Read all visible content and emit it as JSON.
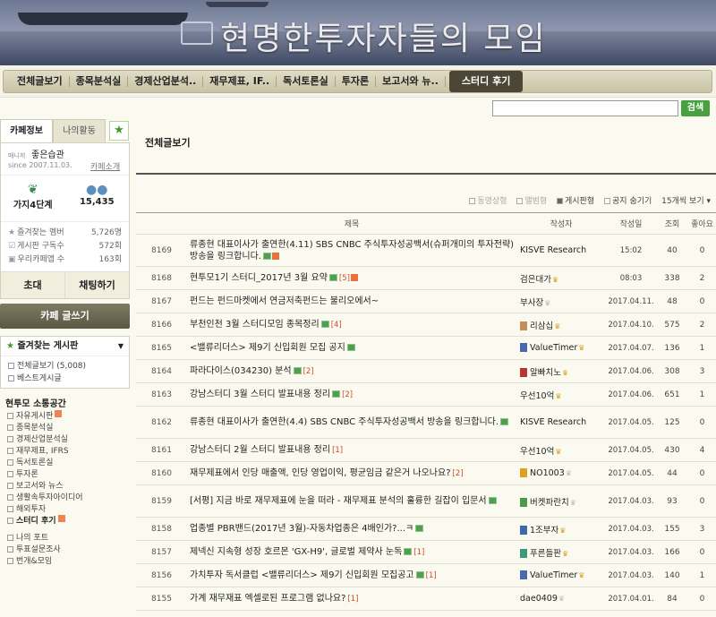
{
  "header": {
    "cafe_title": "현명한투자자들의 모임"
  },
  "nav": {
    "items": [
      "전체글보기",
      "종목분석실",
      "경제산업분석..",
      "재무제표, IF..",
      "독서토론실",
      "투자론",
      "보고서와 뉴.."
    ],
    "active": "스터디 후기"
  },
  "search": {
    "button": "검색"
  },
  "sidebar": {
    "tab_info": "카페정보",
    "tab_activity": "나의활동",
    "manager_tag": "매니저",
    "manager_name": "좋은습관",
    "since": "since 2007.11.03.",
    "intro_link": "카페소개",
    "level": "가지4단계",
    "members": "15,435",
    "meta": [
      {
        "label": "즐겨찾는 멤버",
        "value": "5,726명"
      },
      {
        "label": "게시판 구독수",
        "value": "572회"
      },
      {
        "label": "우리카페앱 수",
        "value": "163회"
      }
    ],
    "btn_invite": "초대",
    "btn_chat": "채팅하기",
    "write_button": "카페 글쓰기",
    "fav_title": "즐겨찾는 게시판",
    "fav_items": [
      "전체글보기 (5,008)",
      "베스트게시글"
    ],
    "section_title": "현투모 소통공간",
    "menu": [
      "자유게시판",
      "종목분석실",
      "경제산업분석실",
      "재무제표, IFRS",
      "독서토론실",
      "투자론",
      "보고서와 뉴스",
      "생활속투자아이디어",
      "해외투자",
      "스터디 후기"
    ],
    "menu2": [
      "나의 포트",
      "투표설문조사",
      "번개&모임"
    ]
  },
  "content": {
    "page_title": "전체글보기",
    "toolbar": {
      "opt1": "동영상형",
      "opt2": "앨범형",
      "opt3": "게시판형",
      "opt4": "공지 숨기기",
      "opt5": "15개씩 보기"
    },
    "columns": [
      "제목",
      "작성자",
      "작성일",
      "조회",
      "좋아요"
    ],
    "rows": [
      {
        "no": "8169",
        "title": "류종현 대표이사가 출연한(4.11) SBS CNBC 주식투자성공백서(슈퍼개미의 투자전략) 방송을 링크합니다.",
        "img": true,
        "cmt": "",
        "new": true,
        "author": "KISVE Research",
        "date": "15:02",
        "views": "40",
        "likes": "0",
        "tall": true
      },
      {
        "no": "8168",
        "title": "현투모1기 스터디_2017년 3월 요약",
        "img": true,
        "cmt": "[5]",
        "new": true,
        "author": "검은대가",
        "date": "08:03",
        "views": "338",
        "likes": "2"
      },
      {
        "no": "8167",
        "title": "펀드는 펀드마켓에서 연금저축펀드는 불리오에서~",
        "img": false,
        "cmt": "",
        "new": false,
        "author": "부사장",
        "date": "2017.04.11.",
        "views": "48",
        "likes": "0"
      },
      {
        "no": "8166",
        "title": "부천인천 3월 스터디모임 종목정리",
        "img": true,
        "cmt": "[4]",
        "new": false,
        "author": "리삼십",
        "date": "2017.04.10.",
        "views": "575",
        "likes": "2"
      },
      {
        "no": "8165",
        "title": "<밸류리더스> 제9기 신입회원 모집 공지",
        "img": true,
        "cmt": "",
        "new": false,
        "author": "ValueTimer",
        "date": "2017.04.07.",
        "views": "136",
        "likes": "1"
      },
      {
        "no": "8164",
        "title": "파라다이스(034230) 분석",
        "img": true,
        "cmt": "[2]",
        "new": false,
        "author": "알빠치노",
        "date": "2017.04.06.",
        "views": "308",
        "likes": "3"
      },
      {
        "no": "8163",
        "title": "강남스터디 3월 스터디 발표내용 정리",
        "img": true,
        "cmt": "[2]",
        "new": false,
        "author": "우선10억",
        "date": "2017.04.06.",
        "views": "651",
        "likes": "1"
      },
      {
        "no": "8162",
        "title": "류종현 대표이사가 출연한(4.4) SBS CNBC 주식투자성공백서 방송을 링크합니다.",
        "img": true,
        "cmt": "",
        "new": false,
        "author": "KISVE Research",
        "date": "2017.04.05.",
        "views": "125",
        "likes": "0",
        "tall": true
      },
      {
        "no": "8161",
        "title": "강남스터디 2월 스터디 발표내용 정리",
        "img": false,
        "cmt": "[1]",
        "new": false,
        "author": "우선10억",
        "date": "2017.04.05.",
        "views": "430",
        "likes": "4"
      },
      {
        "no": "8160",
        "title": "재무제표에서 인당 매출액, 인당 영업이익, 평균임금 같은거 나오나요?",
        "img": false,
        "cmt": "[2]",
        "new": false,
        "author": "NO1003",
        "date": "2017.04.05.",
        "views": "44",
        "likes": "0"
      },
      {
        "no": "8159",
        "title": "[서평] 지금 바로 재무제표에 눈을 떠라 - 재무제표 분석의 훌륭한 길잡이 입문서",
        "img": true,
        "cmt": "",
        "new": false,
        "author": "버켓파란치",
        "date": "2017.04.03.",
        "views": "93",
        "likes": "0",
        "tall": true
      },
      {
        "no": "8158",
        "title": "업종별 PBR밴드(2017년 3월)-자동차업종은 4배인가?...ㅋ",
        "img": true,
        "cmt": "",
        "new": false,
        "author": "1조부자",
        "date": "2017.04.03.",
        "views": "155",
        "likes": "3"
      },
      {
        "no": "8157",
        "title": "제넥신 지속형 성장 호르몬 'GX-H9', 글로벌 제약사 눈독",
        "img": true,
        "cmt": "[1]",
        "new": false,
        "author": "푸른들판",
        "date": "2017.04.03.",
        "views": "166",
        "likes": "0"
      },
      {
        "no": "8156",
        "title": "가치투자 독서클럽 <밸류리더스> 제9기 신입회원 모집공고",
        "img": true,
        "cmt": "[1]",
        "new": false,
        "author": "ValueTimer",
        "date": "2017.04.03.",
        "views": "140",
        "likes": "1"
      },
      {
        "no": "8155",
        "title": "가계 재무재표 엑셀로된 프로그램 없나요?",
        "img": false,
        "cmt": "[1]",
        "new": false,
        "author": "dae0409",
        "date": "2017.04.01.",
        "views": "84",
        "likes": "0"
      }
    ]
  }
}
